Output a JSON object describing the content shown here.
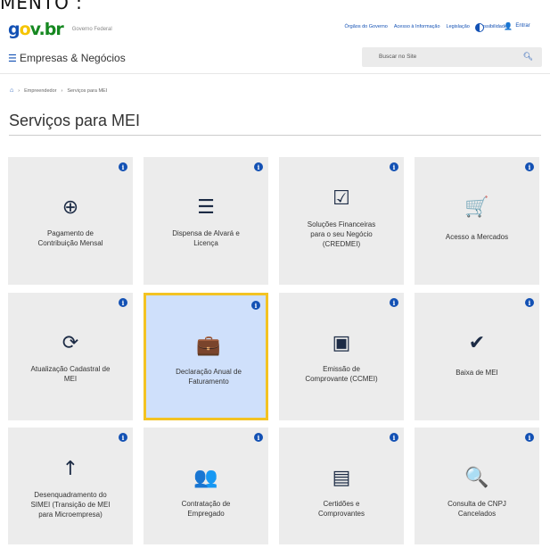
{
  "cut_heading": "MENTO :",
  "header": {
    "logo": {
      "g": "g",
      "o": "o",
      "rest": "v.br"
    },
    "logo_sub": "Governo Federal",
    "links": [
      "Órgãos do Governo",
      "Acesso à Informação",
      "Legislação",
      "Acessibilidade"
    ],
    "login_label": "Entrar",
    "site_name": "Empresas & Negócios",
    "search_placeholder": "Buscar no Site"
  },
  "breadcrumb": [
    "Empreendedor",
    "Serviços para MEI"
  ],
  "page_title": "Serviços para MEI",
  "info_glyph": "i",
  "cards": [
    {
      "icon": "dollar-search-icon",
      "glyph": "⊕",
      "label_lines": [
        "Pagamento de",
        "Contribuição Mensal"
      ],
      "highlighted": false
    },
    {
      "icon": "checklist-icon",
      "glyph": "☰",
      "label_lines": [
        "Dispensa de Alvará e",
        "Licença"
      ],
      "highlighted": false
    },
    {
      "icon": "checkbox-icon",
      "glyph": "☑",
      "label_lines": [
        "Soluções Financeiras",
        "para o seu Negócio",
        "(CREDMEI)"
      ],
      "highlighted": false
    },
    {
      "icon": "cart-icon",
      "glyph": "🛒",
      "label_lines": [
        "Acesso a Mercados"
      ],
      "highlighted": false
    },
    {
      "icon": "sync-icon",
      "glyph": "⟳",
      "label_lines": [
        "Atualização Cadastral de",
        "MEI"
      ],
      "highlighted": false
    },
    {
      "icon": "briefcase-clock-icon",
      "glyph": "💼",
      "label_lines": [
        "Declaração Anual de",
        "Faturamento"
      ],
      "highlighted": true
    },
    {
      "icon": "presentation-icon",
      "glyph": "▣",
      "label_lines": [
        "Emissão de",
        "Comprovante (CCMEI)"
      ],
      "highlighted": false
    },
    {
      "icon": "double-check-icon",
      "glyph": "✔",
      "label_lines": [
        "Baixa de MEI"
      ],
      "highlighted": false
    },
    {
      "icon": "arrow-up-icon",
      "glyph": "↑",
      "label_lines": [
        "Desenquadramento do",
        "SIMEI (Transição de MEI",
        "para Microempresa)"
      ],
      "highlighted": false
    },
    {
      "icon": "users-icon",
      "glyph": "👥",
      "label_lines": [
        "Contratação de",
        "Empregado"
      ],
      "highlighted": false
    },
    {
      "icon": "receipt-icon",
      "glyph": "▤",
      "label_lines": [
        "Certidões e",
        "Comprovantes"
      ],
      "highlighted": false
    },
    {
      "icon": "search-icon",
      "glyph": "🔍",
      "label_lines": [
        "Consulta de CNPJ",
        "Cancelados"
      ],
      "highlighted": false
    }
  ]
}
